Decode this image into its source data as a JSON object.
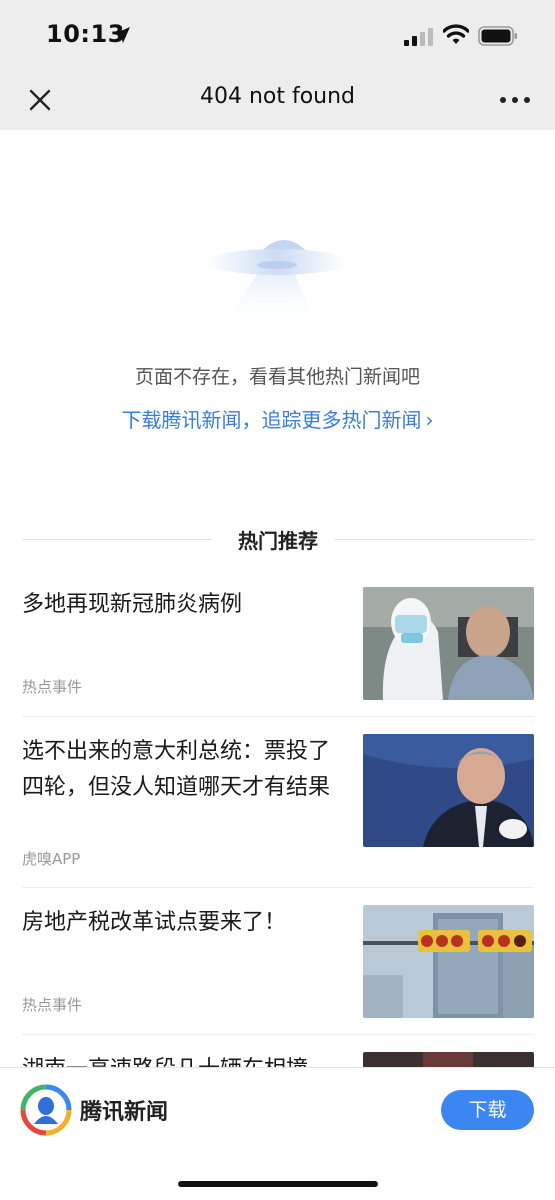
{
  "status_bar": {
    "time": "10:13"
  },
  "nav": {
    "title": "404 not found",
    "close_icon": "close-icon",
    "more_icon": "more-icon"
  },
  "empty_state": {
    "message": "页面不存在，看看其他热门新闻吧",
    "link_text": "下载腾讯新闻，追踪更多热门新闻",
    "link_chevron": "›"
  },
  "section": {
    "title": "热门推荐"
  },
  "news": [
    {
      "title": "多地再现新冠肺炎病例",
      "source": "热点事件"
    },
    {
      "title": "选不出来的意大利总统：票投了四轮，但没人知道哪天才有结果",
      "source": "虎嗅APP"
    },
    {
      "title": "房地产税改革试点要来了！",
      "source": "热点事件"
    },
    {
      "title": "湖南一高速路段几十辆车相撞",
      "source": ""
    }
  ],
  "bottom_bar": {
    "app_name": "腾讯新闻",
    "download_label": "下载"
  },
  "colors": {
    "link": "#3b7cd9",
    "button": "#3b86f0",
    "header_bg": "#ededed"
  }
}
